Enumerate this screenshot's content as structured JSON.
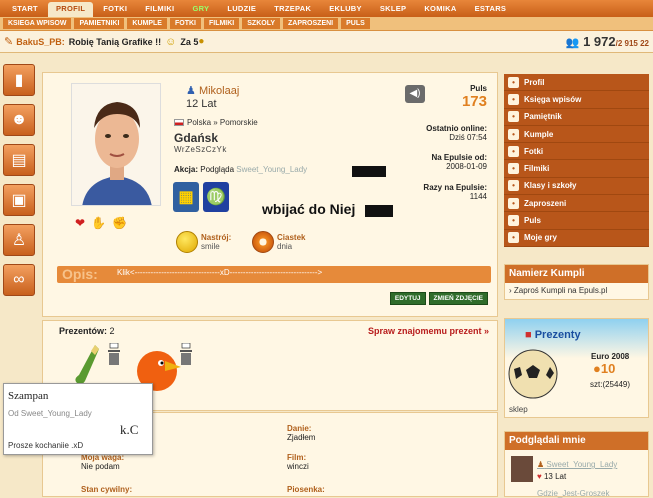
{
  "topnav": [
    "START",
    "PROFIL",
    "FOTKI",
    "FILMIKI",
    "GRY",
    "LUDZIE",
    "TRZEPAK",
    "EKLUBY",
    "SKLEP",
    "KOMIKA",
    "ESTARS"
  ],
  "subnav": [
    "KSIEGA WPISOW",
    "PAMIETNIKI",
    "KUMPLE",
    "FOTKI",
    "FILMIKI",
    "SZKOLY",
    "ZAPROSZENI",
    "PULS"
  ],
  "status": {
    "nick": "BakuS_PB:",
    "text": "Robię Tanią Grafike !!",
    "zalicz": "Za 5",
    "count": "1 972",
    "total": "/2 915 22"
  },
  "profile": {
    "name": "Mikolaaj",
    "age": "12 Lat",
    "location": "Polska » Pomorskie",
    "city": "Gdańsk",
    "nick": "WrZeSzCzYk",
    "akcja_label": "Akcja:",
    "akcja_text": "Podgląda",
    "akcja_user": "Sweet_Young_Lady",
    "wbijac": "wbijać do Niej",
    "mood_label": "Nastrój:",
    "mood_value": "smile",
    "cookie_label": "Ciastek",
    "cookie_value": "dnia",
    "puls_label": "Puls",
    "puls_value": "173",
    "online_label": "Ostatnio online:",
    "online_value": "Dziś 07:54",
    "since_label": "Na Epulsie od:",
    "since_value": "2008-01-09",
    "times_label": "Razy na Epulsie:",
    "times_value": "1144",
    "opis_label": "Opis:",
    "opis_text": "Klik<--------------------------------xD--------------------------------->",
    "edit_btn": "EDYTUJ",
    "photo_btn": "ZMIEŃ ZDJĘCIE"
  },
  "gifts": {
    "label": "Prezentów:",
    "count": "2",
    "action": "Spraw znajomemu prezent »"
  },
  "popup": {
    "title": "Szampan",
    "from": "Od Sweet_Young_Lady",
    "kc": "k.C",
    "msg": "Prosze kochaniie .xD"
  },
  "info": {
    "danie_l": "Danie:",
    "danie_v": "Zjadłem",
    "waga_l": "Moja waga:",
    "waga_v": "Nie podam",
    "film_l": "Film:",
    "film_v": "winczi",
    "stan_l": "Stan cywilny:",
    "piosenka_l": "Piosenka:"
  },
  "rightnav": [
    {
      "label": "Profil",
      "icon": "person-icon"
    },
    {
      "label": "Księga wpisów",
      "icon": "book-icon"
    },
    {
      "label": "Pamiętnik",
      "icon": "diary-icon"
    },
    {
      "label": "Kumple",
      "icon": "friends-icon"
    },
    {
      "label": "Fotki",
      "icon": "photo-icon"
    },
    {
      "label": "Filmiki",
      "icon": "film-icon"
    },
    {
      "label": "Klasy i szkoły",
      "icon": "school-icon"
    },
    {
      "label": "Zaproszeni",
      "icon": "invite-icon"
    },
    {
      "label": "Puls",
      "icon": "puls-icon"
    },
    {
      "label": "Moje gry",
      "icon": "game-icon"
    }
  ],
  "namierz": {
    "title": "Namierz Kumpli",
    "link": "Zaproś Kumpli na Epuls.pl"
  },
  "prezenty": {
    "title": "Prezenty",
    "item": "Euro 2008",
    "price": "10",
    "stock": "szt:(25449)",
    "shop": "sklep"
  },
  "visitors": {
    "title": "Podglądali mnie",
    "user1": "Sweet_Young_Lady",
    "age1": "13 Lat",
    "user2": "Gdzie_Jest-Groszek"
  }
}
